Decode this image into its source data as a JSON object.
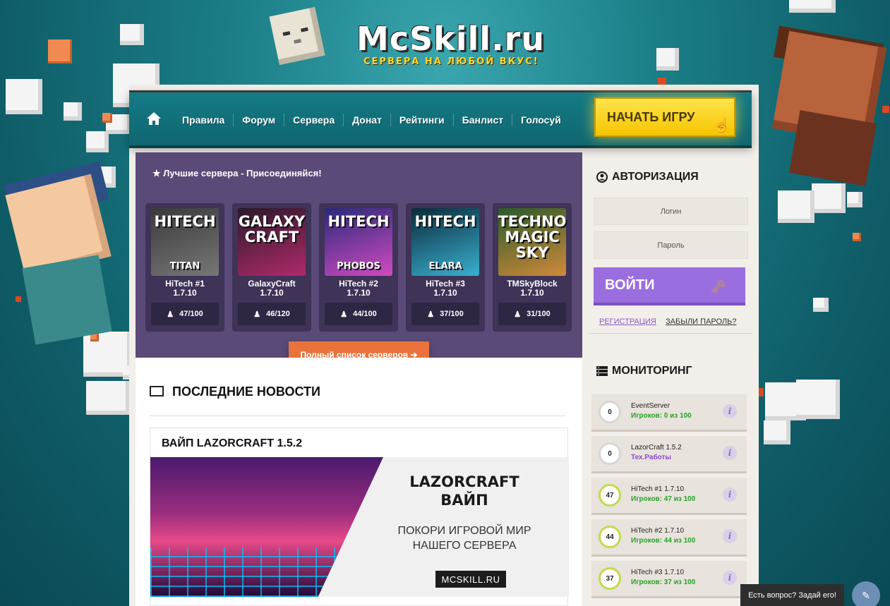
{
  "header": {
    "logo": "McSkill.ru",
    "tagline": "СЕРВЕРА НА ЛЮБОЙ ВКУС!"
  },
  "nav": {
    "items": [
      "Правила",
      "Форум",
      "Сервера",
      "Донат",
      "Рейтинги",
      "Банлист",
      "Голосуй"
    ],
    "play_button": "НАЧАТЬ ИГРУ"
  },
  "servers": {
    "title": "Лучшие сервера - Присоединяйся!",
    "cards": [
      {
        "art_title": "HITECH",
        "art_sub": "TITAN",
        "name": "HiTech #1",
        "version": "1.7.10",
        "players": "47/100",
        "colors": [
          "#3a3a3a",
          "#777777"
        ]
      },
      {
        "art_title": "GALAXY CRAFT",
        "art_sub": "",
        "name": "GalaxyCraft",
        "version": "1.7.10",
        "players": "46/120",
        "colors": [
          "#2a1a2a",
          "#b02a6a"
        ]
      },
      {
        "art_title": "HITECH",
        "art_sub": "PHOBOS",
        "name": "HiTech #2",
        "version": "1.7.10",
        "players": "44/100",
        "colors": [
          "#2a2a7a",
          "#d04ac0"
        ]
      },
      {
        "art_title": "HITECH",
        "art_sub": "ELARA",
        "name": "HiTech #3",
        "version": "1.7.10",
        "players": "37/100",
        "colors": [
          "#0a2a3a",
          "#3ab0d0"
        ]
      },
      {
        "art_title": "TECHNO MAGIC SKY",
        "art_sub": "",
        "name": "TMSkyBlock",
        "version": "1.7.10",
        "players": "31/100",
        "colors": [
          "#2a5a2a",
          "#d08a3a"
        ]
      }
    ],
    "full_list_button": "Полный список серверов ➔"
  },
  "news": {
    "section_title": "ПОСЛЕДНИЕ НОВОСТИ",
    "article_title": "ВАЙП LAZORCRAFT 1.5.2",
    "banner_heading_1": "LAZORCRAFT",
    "banner_heading_2": "ВАЙП",
    "banner_text_1": "ПОКОРИ ИГРОВОЙ МИР",
    "banner_text_2": "НАШЕГО СЕРВЕРА",
    "banner_site": "MCSKILL.RU"
  },
  "auth": {
    "title": "АВТОРИЗАЦИЯ",
    "login_placeholder": "Логин",
    "password_placeholder": "Пароль",
    "login_button": "ВОЙТИ",
    "register_link": "РЕГИСТРАЦИЯ",
    "forgot_link": "ЗАБЫЛИ ПАРОЛЬ?"
  },
  "monitoring": {
    "title": "МОНИТОРИНГ",
    "items": [
      {
        "count": "0",
        "name": "EventServer",
        "status": "Игроков: 0 из 100",
        "status_color": "#2aa02a"
      },
      {
        "count": "0",
        "name": "LazorCraft 1.5.2",
        "status": "Тех.Работы",
        "status_color": "#8a4ad0"
      },
      {
        "count": "47",
        "name": "HiTech #1 1.7.10",
        "status": "Игроков: 47 из 100",
        "status_color": "#2aa02a"
      },
      {
        "count": "44",
        "name": "HiTech #2 1.7.10",
        "status": "Игроков: 44 из 100",
        "status_color": "#2aa02a"
      },
      {
        "count": "37",
        "name": "HiTech #3 1.7.10",
        "status": "Игроков: 37 из 100",
        "status_color": "#2aa02a"
      }
    ]
  },
  "help": {
    "label": "Есть вопрос? Задай его!",
    "icon": "feather-icon"
  }
}
